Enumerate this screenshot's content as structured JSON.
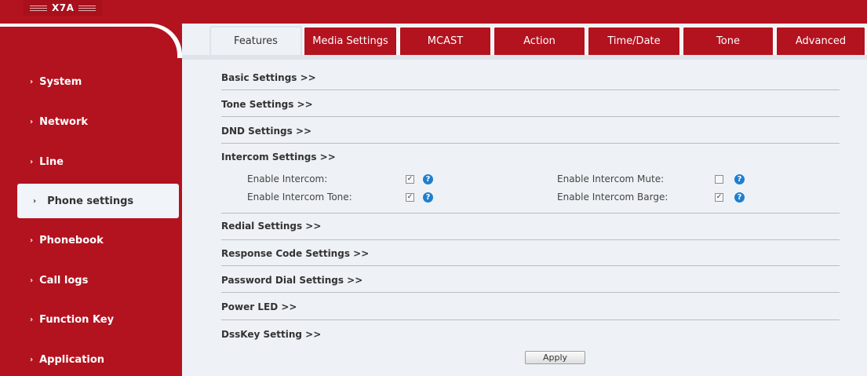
{
  "brand": {
    "name": "X7A"
  },
  "sidebar": {
    "items": [
      {
        "label": "System"
      },
      {
        "label": "Network"
      },
      {
        "label": "Line"
      },
      {
        "label": "Phone settings"
      },
      {
        "label": "Phonebook"
      },
      {
        "label": "Call logs"
      },
      {
        "label": "Function Key"
      },
      {
        "label": "Application"
      }
    ],
    "active": "Phone settings"
  },
  "tabs": [
    {
      "label": "Features"
    },
    {
      "label": "Media Settings"
    },
    {
      "label": "MCAST"
    },
    {
      "label": "Action"
    },
    {
      "label": "Time/Date"
    },
    {
      "label": "Tone"
    },
    {
      "label": "Advanced"
    }
  ],
  "active_tab": "Features",
  "sections": {
    "basic": "Basic Settings >>",
    "tone": "Tone Settings >>",
    "dnd": "DND Settings >>",
    "intercom": "Intercom Settings >>",
    "redial": "Redial Settings >>",
    "response_code": "Response Code Settings >>",
    "password_dial": "Password Dial Settings >>",
    "power_led": "Power LED >>",
    "dsskey": "DssKey Setting >>"
  },
  "intercom": {
    "enable_intercom": {
      "label": "Enable Intercom:",
      "checked": true
    },
    "enable_intercom_tone": {
      "label": "Enable Intercom Tone:",
      "checked": true
    },
    "enable_intercom_mute": {
      "label": "Enable Intercom Mute:",
      "checked": false
    },
    "enable_intercom_barge": {
      "label": "Enable Intercom Barge:",
      "checked": true
    }
  },
  "help_glyph": "?",
  "check_glyph": "✓",
  "apply_label": "Apply",
  "arrow_glyph": "›"
}
